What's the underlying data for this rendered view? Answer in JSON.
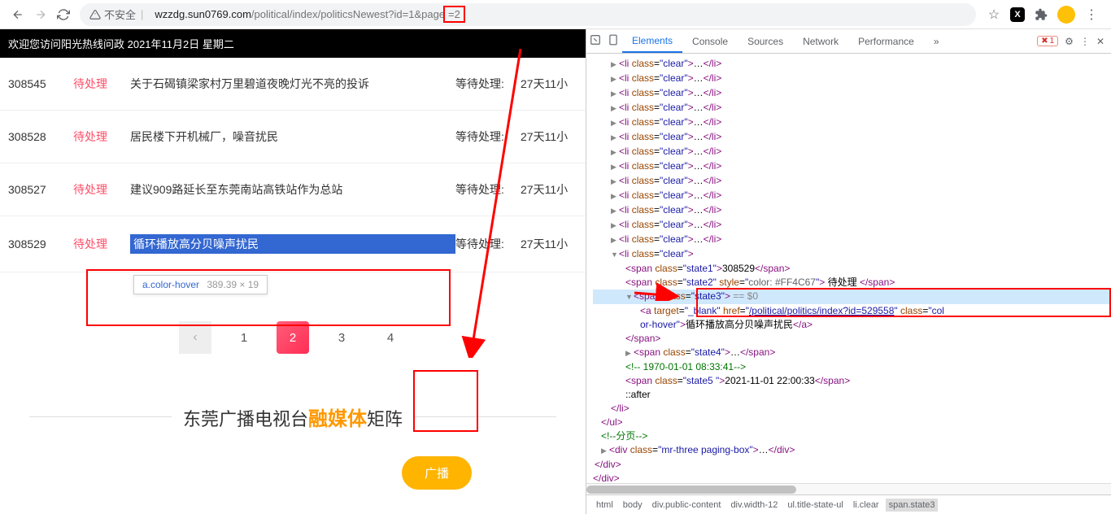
{
  "browser": {
    "security_label": "不安全",
    "url_domain": "wzzdg.sun0769.com",
    "url_path": "/political/index/politicsNewest?id=1&page",
    "url_page_suffix": "=2"
  },
  "header_bar": "欢迎您访问阳光热线问政 2021年11月2日 星期二",
  "rows": [
    {
      "id": "308545",
      "status": "待处理",
      "title": "关于石碣镇梁家村万里碧道夜晚灯光不亮的投诉",
      "wait": "等待处理:",
      "time": "27天11小"
    },
    {
      "id": "308528",
      "status": "待处理",
      "title": "居民楼下开机械厂，噪音扰民",
      "wait": "等待处理:",
      "time": "27天11小"
    },
    {
      "id": "308527",
      "status": "待处理",
      "title": "建议909路延长至东莞南站高铁站作为总站",
      "wait": "等待处理:",
      "time": "27天11小"
    },
    {
      "id": "308529",
      "status": "待处理",
      "title": "循环播放高分贝噪声扰民",
      "wait": "等待处理:",
      "time": "27天11小"
    }
  ],
  "tooltip": {
    "selector": "a.color-hover",
    "dims": "389.39 × 19"
  },
  "pagination": {
    "items": [
      "1",
      "2",
      "3",
      "4"
    ],
    "active": "2"
  },
  "footer": {
    "pre": "东莞广播电视台",
    "orange": "融媒体",
    "post": "矩阵",
    "radio": "广播"
  },
  "devtools": {
    "tabs": [
      "Elements",
      "Console",
      "Sources",
      "Network",
      "Performance"
    ],
    "err_count": "1",
    "li_clear": "<li class=\"clear\">…</li>",
    "expanded_id": "308529",
    "status_text": "待处理",
    "status_color": "#FF4C67",
    "eq0": " == $0",
    "href": "/political/politics/index?id=529558",
    "link_text": "循环播放高分贝噪声扰民",
    "comment1": "<!--                         1970-01-01 08:33:41-->",
    "timestamp": "2021-11-01 22:00:33",
    "after": "::after",
    "paging_comment": "<!--分页-->",
    "paging_div": "<div class=\"mr-three paging-box\">…</div>",
    "breadcrumb": [
      "html",
      "body",
      "div.public-content",
      "div.width-12",
      "ul.title-state-ul",
      "li.clear",
      "span.state3"
    ]
  }
}
